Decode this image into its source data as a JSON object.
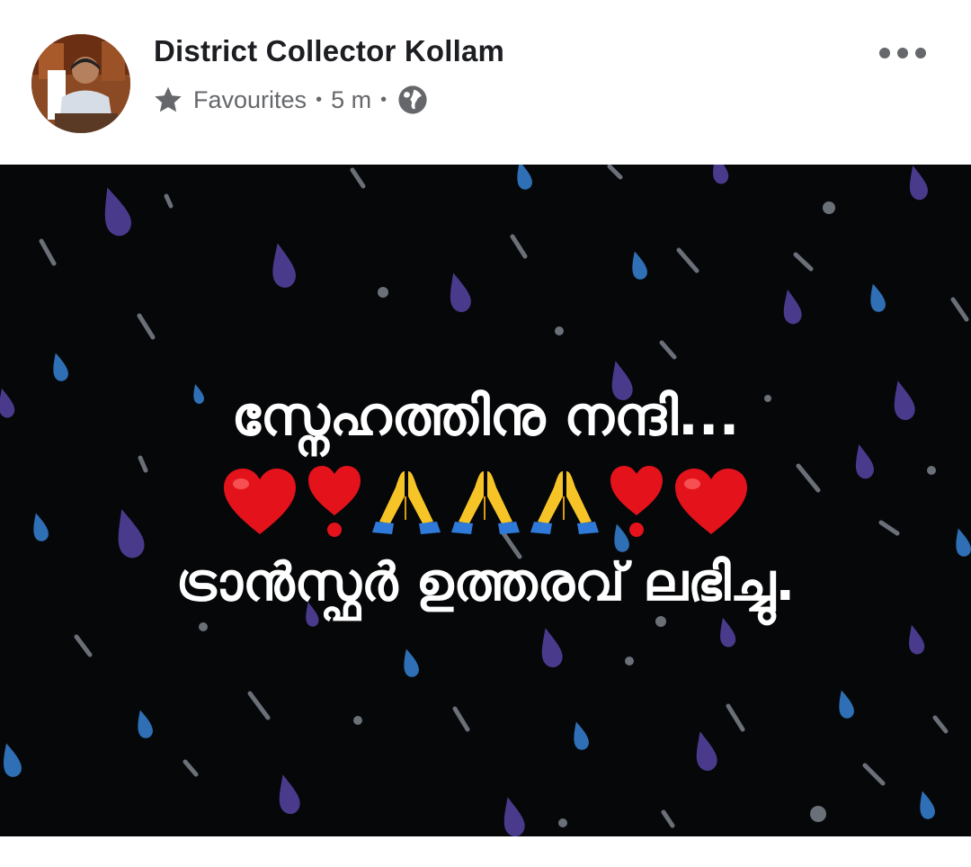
{
  "post": {
    "author_name": "District Collector Kollam",
    "audience_label": "Favourites",
    "timestamp": "5 m",
    "privacy_icon": "globe-icon",
    "audience_icon": "star-icon",
    "more_icon": "more-options-icon"
  },
  "image": {
    "line1": "സ്നേഹത്തിനു നന്ദി...",
    "emojis": [
      "red-heart",
      "heart-exclamation",
      "folded-hands",
      "folded-hands",
      "folded-hands",
      "heart-exclamation",
      "red-heart"
    ],
    "line3": "ട്രാൻസ്ഫർ ഉത്തരവ് ലഭിച്ചു.",
    "background_color": "#050709",
    "drop_colors": [
      "#4a3a8c",
      "#2f6fb5",
      "#8a8f98"
    ]
  }
}
